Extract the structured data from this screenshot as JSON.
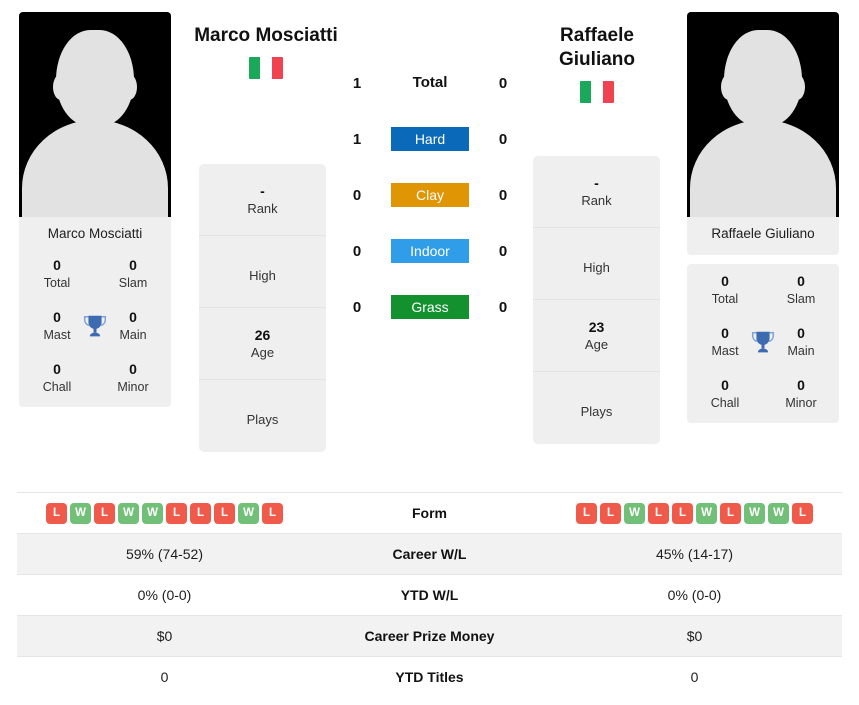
{
  "players": {
    "left": {
      "name": "Marco Mosciatti",
      "photo_caption": "Marco Mosciatti",
      "flag": "italy-flag",
      "titles": {
        "total_value": "0",
        "total_label": "Total",
        "slam_value": "0",
        "slam_label": "Slam",
        "mast_value": "0",
        "mast_label": "Mast",
        "main_value": "0",
        "main_label": "Main",
        "chall_value": "0",
        "chall_label": "Chall",
        "minor_value": "0",
        "minor_label": "Minor"
      },
      "info": {
        "rank_value": "-",
        "rank_label": "Rank",
        "high_value": "",
        "high_label": "High",
        "age_value": "26",
        "age_label": "Age",
        "plays_value": "",
        "plays_label": "Plays"
      },
      "form": [
        "L",
        "W",
        "L",
        "W",
        "W",
        "L",
        "L",
        "L",
        "W",
        "L"
      ],
      "career_wl": "59% (74-52)",
      "ytd_wl": "0% (0-0)",
      "career_prize_money": "$0",
      "ytd_titles": "0"
    },
    "right": {
      "name": "Raffaele Giuliano",
      "name_line1": "Raffaele",
      "name_line2": "Giuliano",
      "photo_caption": "Raffaele Giuliano",
      "flag": "italy-flag",
      "titles": {
        "total_value": "0",
        "total_label": "Total",
        "slam_value": "0",
        "slam_label": "Slam",
        "mast_value": "0",
        "mast_label": "Mast",
        "main_value": "0",
        "main_label": "Main",
        "chall_value": "0",
        "chall_label": "Chall",
        "minor_value": "0",
        "minor_label": "Minor"
      },
      "info": {
        "rank_value": "-",
        "rank_label": "Rank",
        "high_value": "",
        "high_label": "High",
        "age_value": "23",
        "age_label": "Age",
        "plays_value": "",
        "plays_label": "Plays"
      },
      "form": [
        "L",
        "L",
        "W",
        "L",
        "L",
        "W",
        "L",
        "W",
        "W",
        "L"
      ],
      "career_wl": "45% (14-17)",
      "ytd_wl": "0% (0-0)",
      "career_prize_money": "$0",
      "ytd_titles": "0"
    }
  },
  "h2h": {
    "rows": [
      {
        "label": "Total",
        "left": "1",
        "right": "0",
        "type": "total",
        "color": ""
      },
      {
        "label": "Hard",
        "left": "1",
        "right": "0",
        "type": "surface",
        "color": "#0a69b8"
      },
      {
        "label": "Clay",
        "left": "0",
        "right": "0",
        "type": "surface",
        "color": "#e09504"
      },
      {
        "label": "Indoor",
        "left": "0",
        "right": "0",
        "type": "surface",
        "color": "#2f9de8"
      },
      {
        "label": "Grass",
        "left": "0",
        "right": "0",
        "type": "surface",
        "color": "#14912f"
      }
    ]
  },
  "comparison_table": {
    "rows": [
      {
        "label": "Form"
      },
      {
        "label": "Career W/L"
      },
      {
        "label": "YTD W/L"
      },
      {
        "label": "Career Prize Money"
      },
      {
        "label": "YTD Titles"
      }
    ]
  },
  "colors": {
    "hard": "#0a69b8",
    "clay": "#e09504",
    "indoor": "#2f9de8",
    "grass": "#14912f",
    "win": "#72bf78",
    "loss": "#f05a4a",
    "trophy": "#3d6ab0",
    "panel_bg": "#efefef",
    "row_shade": "#f2f2f2"
  }
}
